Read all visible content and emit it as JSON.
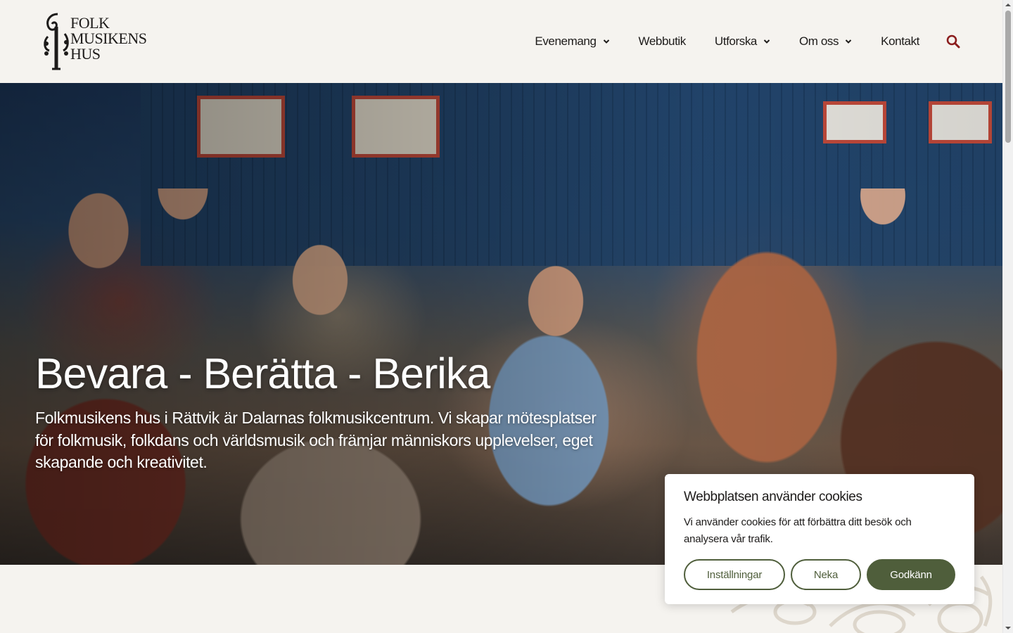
{
  "site": {
    "logo_text": [
      "FOLK",
      "MUSIKENS",
      "HUS"
    ],
    "logo_icon": "violin-scroll-icon"
  },
  "nav": {
    "items": [
      {
        "label": "Evenemang",
        "has_dropdown": true
      },
      {
        "label": "Webbutik",
        "has_dropdown": false
      },
      {
        "label": "Utforska",
        "has_dropdown": true
      },
      {
        "label": "Om oss",
        "has_dropdown": true
      },
      {
        "label": "Kontakt",
        "has_dropdown": false
      }
    ],
    "search_icon": "search-icon"
  },
  "hero": {
    "title": "Bevara - Berätta - Berika",
    "text": "Folkmusikens hus i Rättvik är Dalarnas folkmusikcentrum. Vi skapar mötesplatser för folkmusik, folkdans och världsmusik och främjar människors upplevelser, eget skapande och kreativitet."
  },
  "cookie_banner": {
    "title": "Webbplatsen använder cookies",
    "text": "Vi använder cookies för att förbättra ditt besök och analysera vår trafik.",
    "settings_label": "Inställningar",
    "deny_label": "Neka",
    "accept_label": "Godkänn"
  },
  "colors": {
    "background": "#f5f3ef",
    "accent_green": "#4f5e3b",
    "search_red": "#8b1d1d",
    "text": "#1d1b1a"
  }
}
